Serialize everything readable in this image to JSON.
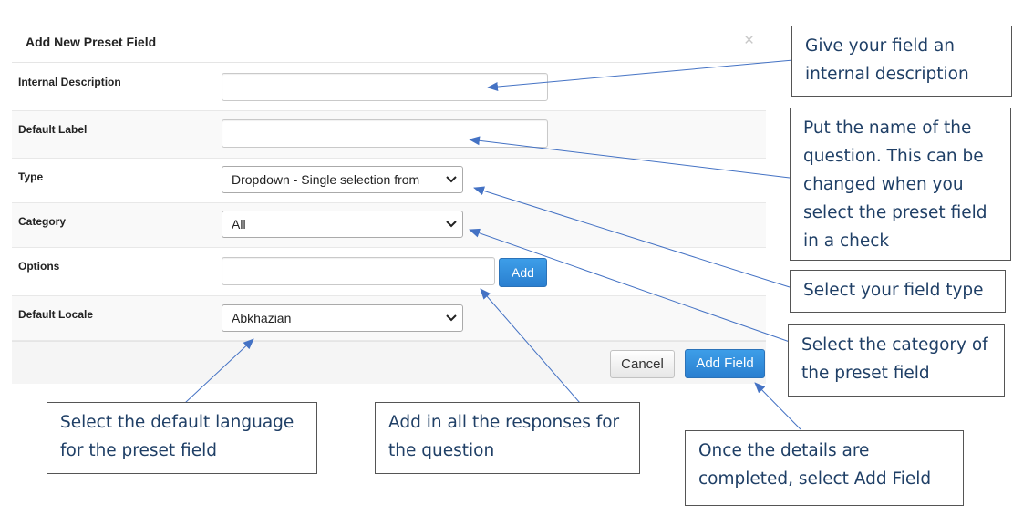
{
  "dialog": {
    "title": "Add New Preset Field",
    "close_symbol": "×",
    "fields": {
      "internal_description": {
        "label": "Internal Description",
        "value": ""
      },
      "default_label": {
        "label": "Default Label",
        "value": ""
      },
      "type": {
        "label": "Type",
        "value": "Dropdown - Single selection from"
      },
      "category": {
        "label": "Category",
        "value": "All"
      },
      "options": {
        "label": "Options",
        "value": "",
        "add_label": "Add"
      },
      "default_locale": {
        "label": "Default Locale",
        "value": "Abkhazian"
      }
    },
    "footer": {
      "cancel_label": "Cancel",
      "add_field_label": "Add Field"
    }
  },
  "callouts": {
    "internal_description": "Give your field an internal description",
    "default_label": "Put the name of the question. This can be changed when you select the preset field in a check",
    "type": "Select your field type",
    "category": "Select the category of the preset field",
    "add_field": "Once the details are completed, select Add Field",
    "options": "Add in all the responses for the question",
    "default_locale": "Select the default language for the preset field"
  },
  "colors": {
    "primary_button": "#2a7fd0",
    "callout_text": "#1f3f66",
    "arrow": "#4472c4"
  },
  "icons": {
    "close": "close-icon",
    "dropdown": "chevron-down-icon"
  }
}
